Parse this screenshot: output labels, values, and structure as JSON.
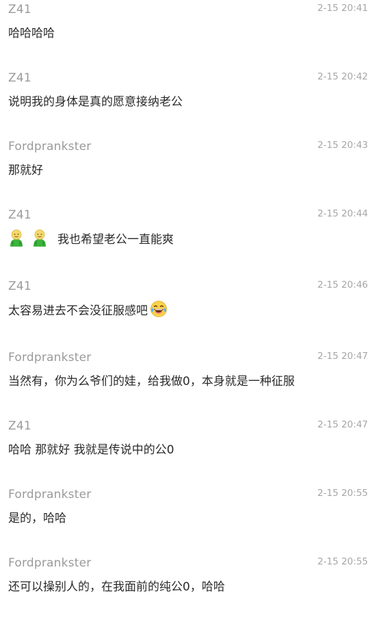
{
  "messages": [
    {
      "author": "Z41",
      "time": "2-15 20:41",
      "text": "哈哈哈哈"
    },
    {
      "author": "Z41",
      "time": "2-15 20:42",
      "text": "说明我的身体是真的愿意接纳老公"
    },
    {
      "author": "Fordprankster",
      "time": "2-15 20:43",
      "text": "那就好"
    },
    {
      "author": "Z41",
      "time": "2-15 20:44",
      "text": "我也希望老公一直能爽",
      "emoji_prefix": [
        "green-person-icon",
        "green-person-icon"
      ]
    },
    {
      "author": "Z41",
      "time": "2-15 20:46",
      "text": "太容易进去不会没征服感吧",
      "emoji_suffix": "laughing-tears-icon"
    },
    {
      "author": "Fordprankster",
      "time": "2-15 20:47",
      "text": "当然有，你为么爷们的娃，给我做0，本身就是一种征服"
    },
    {
      "author": "Z41",
      "time": "2-15 20:47",
      "text": "哈哈 那就好 我就是传说中的公0"
    },
    {
      "author": "Fordprankster",
      "time": "2-15 20:55",
      "text": "是的，哈哈"
    },
    {
      "author": "Fordprankster",
      "time": "2-15 20:55",
      "text": "还可以操别人的，在我面前的纯公0，哈哈"
    }
  ]
}
